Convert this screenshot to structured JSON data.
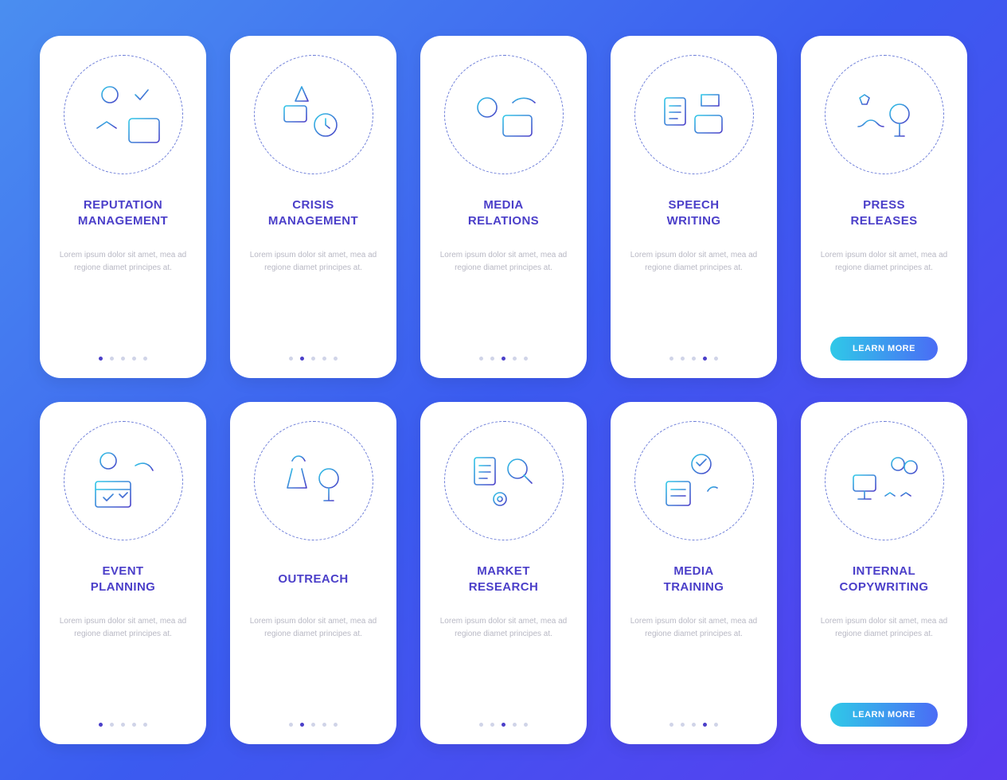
{
  "lorem": "Lorem ipsum dolor sit amet, mea ad regione diamet principes at.",
  "button_label": "LEARN MORE",
  "grad_a": "#2fc9e8",
  "grad_b": "#4b3fc9",
  "cards": [
    {
      "id": "reputation-management",
      "title": "REPUTATION\nMANAGEMENT",
      "active": 0,
      "button": false,
      "icon": "reputation"
    },
    {
      "id": "crisis-management",
      "title": "CRISIS\nMANAGEMENT",
      "active": 1,
      "button": false,
      "icon": "crisis"
    },
    {
      "id": "media-relations",
      "title": "MEDIA\nRELATIONS",
      "active": 2,
      "button": false,
      "icon": "media-rel"
    },
    {
      "id": "speech-writing",
      "title": "SPEECH\nWRITING",
      "active": 3,
      "button": false,
      "icon": "speech"
    },
    {
      "id": "press-releases",
      "title": "PRESS\nRELEASES",
      "active": 4,
      "button": true,
      "icon": "press"
    },
    {
      "id": "event-planning",
      "title": "EVENT\nPLANNING",
      "active": 0,
      "button": false,
      "icon": "event"
    },
    {
      "id": "outreach",
      "title": "OUTREACH",
      "active": 1,
      "button": false,
      "icon": "outreach"
    },
    {
      "id": "market-research",
      "title": "MARKET\nRESEARCH",
      "active": 2,
      "button": false,
      "icon": "market"
    },
    {
      "id": "media-training",
      "title": "MEDIA\nTRAINING",
      "active": 3,
      "button": false,
      "icon": "training"
    },
    {
      "id": "internal-copywriting",
      "title": "INTERNAL\nCOPYWRITING",
      "active": 4,
      "button": true,
      "icon": "copy"
    }
  ]
}
